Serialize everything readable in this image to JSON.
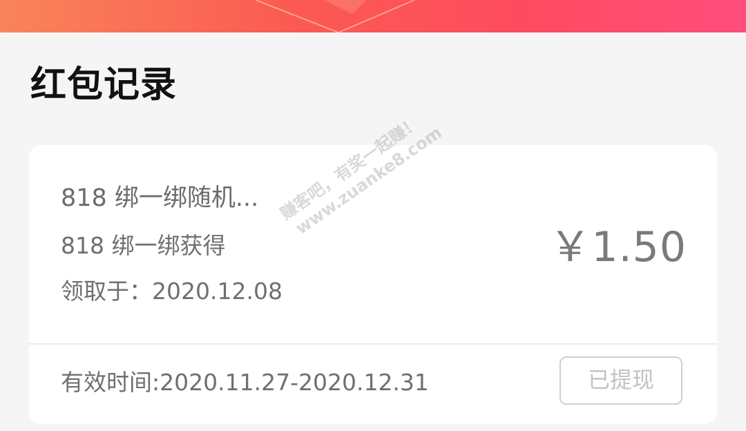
{
  "header": {
    "banner_colors": [
      "#f9845a",
      "#fb5a52",
      "#fd4b5e",
      "#ff4d7d"
    ]
  },
  "page": {
    "title": "红包记录"
  },
  "record": {
    "name": "818 绑一绑随机...",
    "source": "818 绑一绑获得",
    "received_at": "领取于：2020.12.08",
    "amount": "￥1.50",
    "validity": "有效时间:2020.11.27-2020.12.31",
    "status_label": "已提现"
  },
  "watermark": {
    "line1": "赚客吧，有奖一起赚！",
    "line2": "www.zuanke8.com"
  }
}
